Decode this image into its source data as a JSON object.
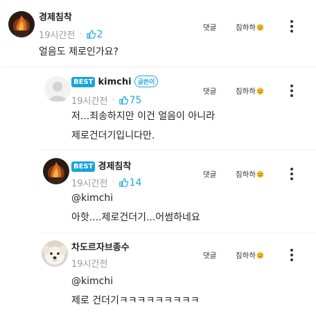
{
  "comments": [
    {
      "author": "경제침착",
      "best": "",
      "badge": "",
      "time": "19시간전",
      "likes": "2",
      "lines": [
        "얼음도 제로인가요?"
      ],
      "reply_label": "댓글",
      "react_label": "침하하",
      "avatar_icon": "fire-avatar-icon"
    },
    {
      "author": "kimchi",
      "best": "BEST",
      "badge": "글쓴이",
      "time": "19시간전",
      "likes": "75",
      "lines": [
        "저...죄송하지만 이건 얼음이 아니라",
        "제로건더기입니다만."
      ],
      "reply_label": "댓글",
      "react_label": "침하하",
      "avatar_icon": "default-user-icon"
    },
    {
      "author": "경제침착",
      "best": "BEST",
      "badge": "",
      "time": "19시간전",
      "likes": "14",
      "mention": "@kimchi",
      "lines": [
        "아핫....제로건더기...어썸하네요"
      ],
      "reply_label": "댓글",
      "react_label": "침하하",
      "avatar_icon": "fire-avatar-icon"
    },
    {
      "author": "차도르자브종수",
      "best": "",
      "badge": "",
      "time": "19시간전",
      "likes": "",
      "mention": "@kimchi",
      "lines": [
        "제로 건더기ㅋㅋㅋㅋㅋㅋㅋㅋㅋ"
      ],
      "reply_label": "댓글",
      "react_label": "침하하",
      "avatar_icon": "dog-avatar-icon"
    }
  ],
  "colors": {
    "accent": "#1aa8e0",
    "best_bg": "#19a5d8",
    "meta": "#9a9a9a"
  },
  "icons": {
    "like": "thumbs-up-icon",
    "more": "more-vertical-icon",
    "react": "smile-emoji-icon"
  }
}
